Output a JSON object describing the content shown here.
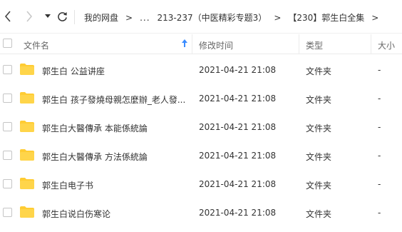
{
  "toolbar": {
    "back_icon": "chevron-left-icon",
    "forward_icon": "chevron-right-icon",
    "dropdown_icon": "caret-down-icon",
    "refresh_icon": "refresh-icon"
  },
  "breadcrumb": {
    "root": "我的网盘",
    "ellipsis": "...",
    "folder1": "213-237（中医精彩专题3）",
    "folder2": "【230】郭生白全集",
    "separator": ">"
  },
  "columns": {
    "name": "文件名",
    "modified": "修改时间",
    "type": "类型",
    "size": "大小"
  },
  "colors": {
    "folder": "#ffcc33",
    "sort_arrow": "#3b8cff"
  },
  "files": [
    {
      "name": "郭生白 公益讲座",
      "modified": "2021-04-21 21:08",
      "type": "文件夹",
      "size": "-"
    },
    {
      "name": "郭生白 孩子發燒母親怎麼辦_老人發...",
      "modified": "2021-04-21 21:08",
      "type": "文件夹",
      "size": "-"
    },
    {
      "name": "郭生白大醫傳承 本能係統論",
      "modified": "2021-04-21 21:08",
      "type": "文件夹",
      "size": "-"
    },
    {
      "name": "郭生白大醫傳承 方法係統論",
      "modified": "2021-04-21 21:08",
      "type": "文件夹",
      "size": "-"
    },
    {
      "name": "郭生白电子书",
      "modified": "2021-04-21 21:08",
      "type": "文件夹",
      "size": "-"
    },
    {
      "name": "郭生白说白伤寒论",
      "modified": "2021-04-21 21:08",
      "type": "文件夹",
      "size": "-"
    }
  ]
}
